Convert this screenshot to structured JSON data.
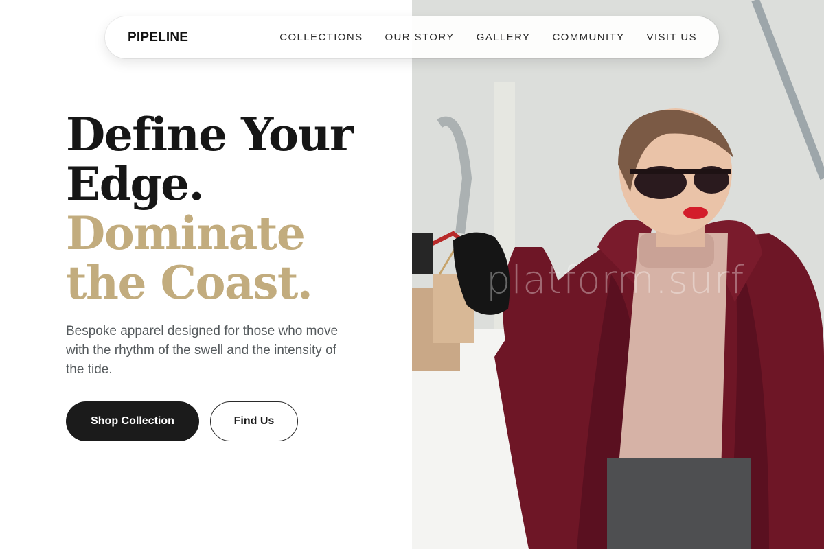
{
  "nav": {
    "brand": "PIPELINE",
    "links": [
      "COLLECTIONS",
      "OUR STORY",
      "GALLERY",
      "COMMUNITY",
      "VISIT US"
    ]
  },
  "hero": {
    "title_line1": "Define Your",
    "title_line2": "Edge.",
    "title_line3": "Dominate",
    "title_line4": "the Coast.",
    "subtitle": "Bespoke apparel designed for those who move with the rhythm of the swell and the intensity of the tide.",
    "primary_button": "Shop Collection",
    "secondary_button": "Find Us"
  },
  "photo": {
    "watermark": "platform.surf"
  },
  "colors": {
    "accent_gold": "#c2ac7e",
    "dark": "#1b1b1b",
    "coat": "#6e1626"
  }
}
